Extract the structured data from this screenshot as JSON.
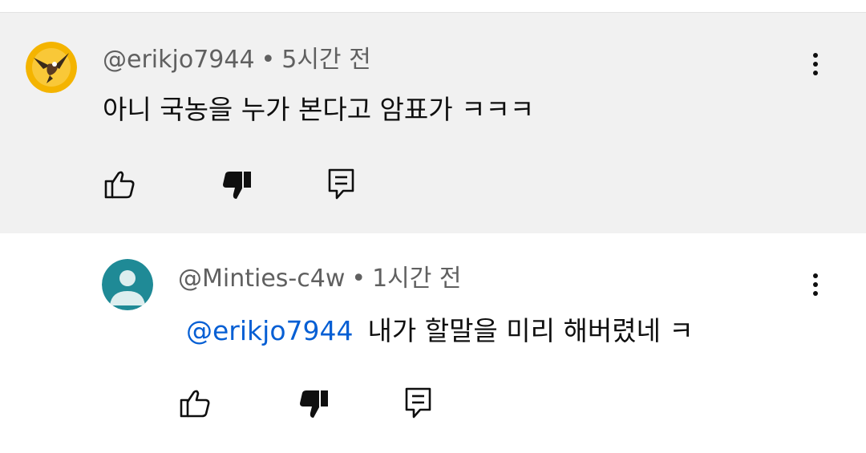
{
  "comments": [
    {
      "username": "@erikjo7944",
      "separator": "•",
      "time": "5시간 전",
      "text": "아니 국농을 누가 본다고 암표가 ㅋㅋㅋ",
      "avatar_icon": "eagle-avatar",
      "avatar_bg": "#f4b400"
    }
  ],
  "reply": {
    "username": "@Minties-c4w",
    "separator": "•",
    "time": "1시간 전",
    "mention": "@erikjo7944",
    "text": "내가 할말을 미리 해버렸네 ㅋ",
    "avatar_icon": "default-person-avatar",
    "avatar_bg": "#1f8a96"
  },
  "actions": {
    "like_icon": "thumbs-up-icon",
    "dislike_icon": "thumbs-down-icon",
    "reply_icon": "reply-comment-icon",
    "more_icon": "more-vert-icon"
  },
  "colors": {
    "highlight_bg": "#f1f1f1",
    "mention": "#065fd4",
    "meta_text": "#606060",
    "body_text": "#0f0f0f"
  }
}
